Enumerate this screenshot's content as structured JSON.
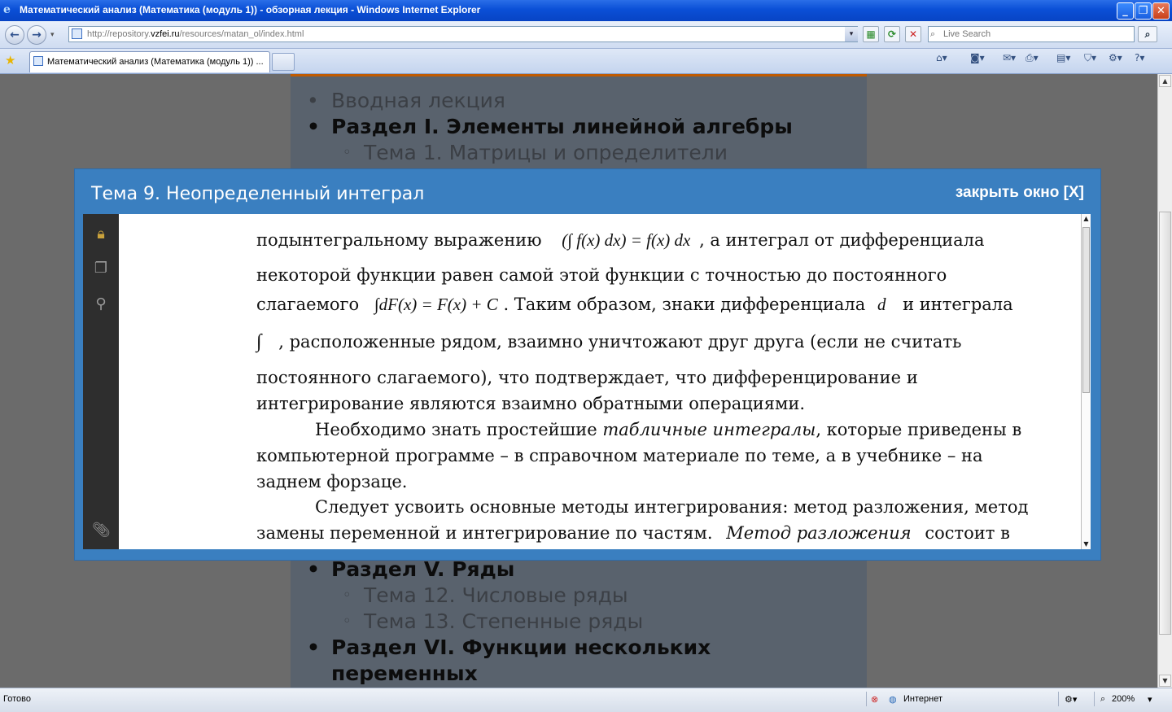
{
  "window": {
    "title": "Математический анализ (Математика (модуль 1)) - обзорная лекция - Windows Internet Explorer",
    "min_glyph": "_",
    "max_glyph": "❐",
    "close_glyph": "✕"
  },
  "nav": {
    "back_glyph": "←",
    "forward_glyph": "→",
    "dropdown_glyph": "▾"
  },
  "address": {
    "url_prefix": "http://repository.",
    "url_domain": "vzfei.ru",
    "url_suffix": "/resources/matan_ol/index.html"
  },
  "search": {
    "placeholder": "Live Search"
  },
  "tab": {
    "label": "Математический анализ (Математика (модуль 1)) ..."
  },
  "outline": {
    "top": [
      {
        "text": "Вводная лекция",
        "kind": "muted",
        "bullet": "•"
      },
      {
        "text": "Раздел I. Элементы линейной алгебры",
        "kind": "bold",
        "bullet": "•"
      },
      {
        "text": "Тема 1. Матрицы и определители",
        "kind": "sub",
        "bullet": "◦"
      }
    ],
    "bottom": [
      {
        "text": "Раздел V. Ряды",
        "kind": "bold",
        "bullet": "•"
      },
      {
        "text": "Тема 12. Числовые ряды",
        "kind": "sub",
        "bullet": "◦"
      },
      {
        "text": "Тема 13. Степенные ряды",
        "kind": "sub",
        "bullet": "◦"
      },
      {
        "text": "Раздел VI. Функции нескольких",
        "kind": "bold",
        "bullet": "•"
      },
      {
        "text": "переменных",
        "kind": "bold",
        "bullet": ""
      }
    ]
  },
  "modal": {
    "title": "Тема 9. Неопределенный интеграл",
    "close_label": "закрыть окно [X]"
  },
  "document": {
    "l1_text": "подынтегральному выражению",
    "l1_math": "(∫ f(x) dx) = f(x) dx",
    "l1_tail": ", а интеграл от дифференциала",
    "l2_text": "некоторой функции равен самой этой функции с точностью до постоянного",
    "l3_text": "слагаемого",
    "l3_math": "∫dF(x) = F(x) + C",
    "l3_tail": ". Таким образом, знаки дифференциала",
    "l3_d": "d",
    "l3_end": "и интеграла",
    "l4_int": "∫",
    "l4_text": ", расположенные рядом, взаимно уничтожают друг друга (если не считать",
    "l5_text": "постоянного слагаемого), что подтверждает, что дифференцирование и",
    "l6_text": "интегрирование являются взаимно обратными операциями.",
    "l7_text_a": "Необходимо знать простейшие",
    "l7_italic": "табличные интегралы",
    "l7_text_b": ", которые приведены в",
    "l8_text": "компьютерной программе – в справочном материале по теме, а в учебнике – на",
    "l9_text": "заднем форзаце.",
    "l10_text": "Следует усвоить основные методы интегрирования: метод разложения, метод",
    "l11_text": "замены переменной и интегрирование по частям.",
    "l11_italic": "Метод разложения",
    "l11_tail": "состоит в"
  },
  "statusbar": {
    "status": "Готово",
    "zone": "Интернет",
    "zoom": "200%"
  },
  "colors": {
    "modal_bg": "#3a7fc0",
    "page_bg": "#59626d",
    "accent_line": "#c05a00"
  }
}
